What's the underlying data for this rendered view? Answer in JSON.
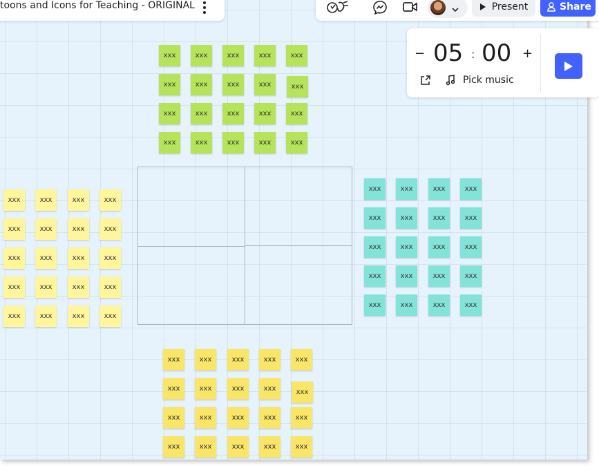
{
  "board": {
    "title": "toons and Icons for Teaching - ORIGINAL"
  },
  "toolbar": {
    "present_label": "Present",
    "share_label": "Share",
    "icons": [
      "reactions-icon",
      "chat-icon",
      "video-call-icon",
      "avatar",
      "chevron-down-icon"
    ]
  },
  "timer": {
    "minus": "−",
    "minutes": "05",
    "colon": ":",
    "seconds": "00",
    "plus": "+",
    "pick_music_label": "Pick music"
  },
  "stickies": {
    "label": "xxx",
    "colors": {
      "green": "#b5e35a",
      "yellow": "#fff59b",
      "yellow_bottom": "#f9e567",
      "teal": "#84e3d9"
    }
  },
  "colors": {
    "accent": "#4262ff",
    "canvas": "#e6f3fc"
  }
}
